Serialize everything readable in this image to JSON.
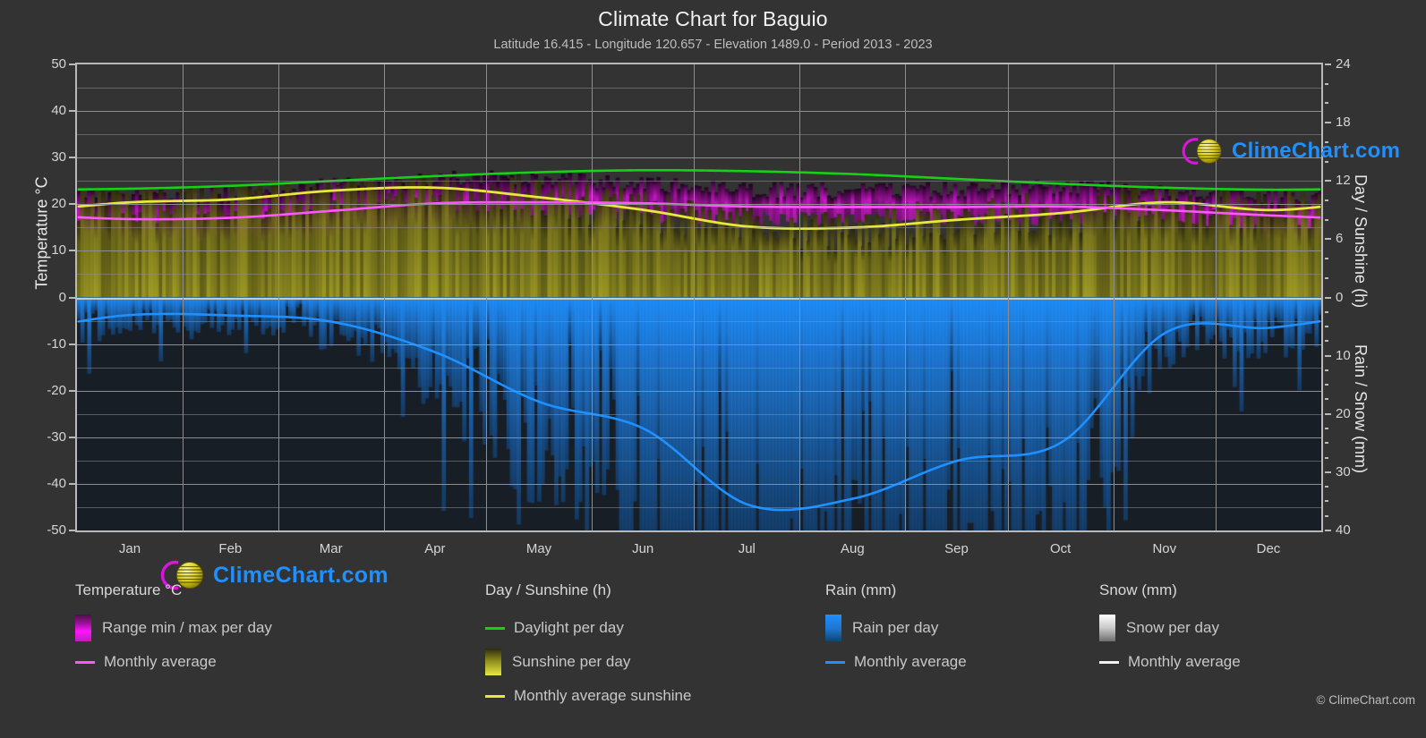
{
  "header": {
    "title": "Climate Chart for Baguio",
    "subtitle": "Latitude 16.415 - Longitude 120.657 - Elevation 1489.0 - Period 2013 - 2023"
  },
  "axes": {
    "left_label": "Temperature °C",
    "right_label_top": "Day / Sunshine (h)",
    "right_label_bottom": "Rain / Snow (mm)",
    "left_ticks": [
      "50",
      "40",
      "30",
      "20",
      "10",
      "0",
      "-10",
      "-20",
      "-30",
      "-40",
      "-50"
    ],
    "right_ticks_top": [
      "24",
      "18",
      "12",
      "6",
      "0"
    ],
    "right_ticks_bottom": [
      "0",
      "10",
      "20",
      "30",
      "40"
    ],
    "x_ticks": [
      "Jan",
      "Feb",
      "Mar",
      "Apr",
      "May",
      "Jun",
      "Jul",
      "Aug",
      "Sep",
      "Oct",
      "Nov",
      "Dec"
    ]
  },
  "legend": {
    "temperature": {
      "title": "Temperature °C",
      "items": [
        {
          "label": "Range min / max per day",
          "type": "area",
          "color": "#ff14ff"
        },
        {
          "label": "Monthly average",
          "type": "line",
          "color": "#ff57ff"
        }
      ]
    },
    "day_sunshine": {
      "title": "Day / Sunshine (h)",
      "items": [
        {
          "label": "Daylight per day",
          "type": "line",
          "color": "#15d215"
        },
        {
          "label": "Sunshine per day",
          "type": "area",
          "color": "#e8e840"
        },
        {
          "label": "Monthly average sunshine",
          "type": "line",
          "color": "#e8e83c"
        }
      ]
    },
    "rain": {
      "title": "Rain (mm)",
      "items": [
        {
          "label": "Rain per day",
          "type": "area",
          "color": "#1e90ff"
        },
        {
          "label": "Monthly average",
          "type": "line",
          "color": "#1e90ff"
        }
      ]
    },
    "snow": {
      "title": "Snow (mm)",
      "items": [
        {
          "label": "Snow per day",
          "type": "area",
          "color": "#ffffff"
        },
        {
          "label": "Monthly average",
          "type": "line",
          "color": "#f2f2f2"
        }
      ]
    }
  },
  "watermark": {
    "text": "ClimeChart.com",
    "copyright": "© ClimeChart.com"
  },
  "chart_data": {
    "type": "area",
    "title": "Climate Chart for Baguio",
    "subtitle": "Latitude 16.415 - Longitude 120.657 - Elevation 1489.0 - Period 2013 - 2023",
    "xlabel": "",
    "ylabel": "Temperature °C",
    "ylabel_right_top": "Day / Sunshine (h)",
    "ylabel_right_bottom": "Rain / Snow (mm)",
    "ylim": [
      -50,
      50
    ],
    "ylim_right_top": [
      0,
      24
    ],
    "ylim_right_bottom": [
      0,
      40
    ],
    "grid": true,
    "legend_position": "below",
    "categories": [
      "Jan",
      "Feb",
      "Mar",
      "Apr",
      "May",
      "Jun",
      "Jul",
      "Aug",
      "Sep",
      "Oct",
      "Nov",
      "Dec"
    ],
    "series": [
      {
        "name": "Monthly average temperature",
        "unit": "°C",
        "axis": "left",
        "color": "#ff57ff",
        "values": [
          16.8,
          17.1,
          18.6,
          20.2,
          20.4,
          20.2,
          19.5,
          19.4,
          19.4,
          19.5,
          18.7,
          17.6
        ]
      },
      {
        "name": "Daily temperature max",
        "unit": "°C",
        "axis": "left",
        "color": "#ff14ff",
        "values": [
          21.6,
          22.5,
          24.2,
          25.8,
          25.3,
          24.3,
          23.2,
          23.0,
          23.2,
          23.6,
          22.8,
          21.8
        ]
      },
      {
        "name": "Daily temperature min",
        "unit": "°C",
        "axis": "left",
        "color": "#a211a0",
        "values": [
          13.2,
          13.5,
          14.6,
          16.2,
          17.2,
          17.3,
          17.0,
          16.9,
          16.8,
          16.6,
          15.6,
          14.2
        ]
      },
      {
        "name": "Daylight per day",
        "unit": "h",
        "axis": "right_top",
        "color": "#15d215",
        "values": [
          11.2,
          11.5,
          12.0,
          12.5,
          12.9,
          13.1,
          13.0,
          12.7,
          12.2,
          11.7,
          11.3,
          11.1
        ]
      },
      {
        "name": "Monthly average sunshine",
        "unit": "h",
        "axis": "right_top",
        "color": "#e8e83c",
        "values": [
          9.8,
          10.1,
          11.0,
          11.3,
          10.3,
          9.0,
          7.3,
          7.2,
          8.0,
          8.7,
          9.8,
          9.0
        ]
      },
      {
        "name": "Monthly average rain",
        "unit": "mm",
        "axis": "right_bottom",
        "color": "#1e90ff",
        "values": [
          3.0,
          3.1,
          4.2,
          9.5,
          18.0,
          22.6,
          35.6,
          34.5,
          28.0,
          24.8,
          6.0,
          5.2
        ]
      },
      {
        "name": "Monthly average snow",
        "unit": "mm",
        "axis": "right_bottom",
        "color": "#f2f2f2",
        "values": [
          0,
          0,
          0,
          0,
          0,
          0,
          0,
          0,
          0,
          0,
          0,
          0
        ]
      }
    ]
  }
}
